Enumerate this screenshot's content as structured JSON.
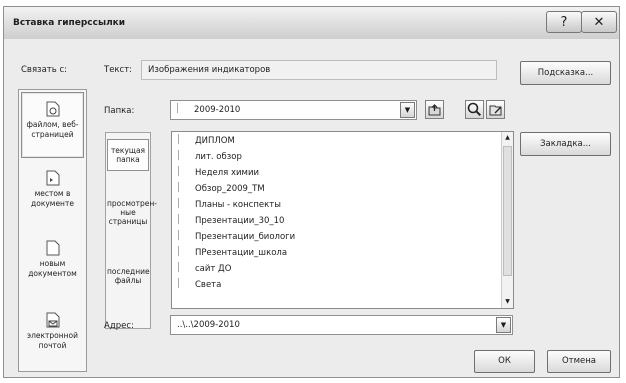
{
  "window": {
    "title": "Вставка гиперссылки",
    "help_glyph": "?",
    "close_glyph": "✕"
  },
  "link_to_label": "Связать с:",
  "link_options": [
    {
      "line1": "файлом, веб-",
      "line2": "страницей",
      "icon": "file-web-icon"
    },
    {
      "line1": "местом в",
      "line2": "документе",
      "icon": "document-place-icon"
    },
    {
      "line1": "новым",
      "line2": "документом",
      "icon": "new-document-icon"
    },
    {
      "line1": "электронной",
      "line2": "почтой",
      "icon": "email-icon"
    }
  ],
  "text": {
    "label": "Текст:",
    "value": "Изображения индикаторов"
  },
  "hint_button": "Подсказка...",
  "folder": {
    "label": "Папка:",
    "value": "2009-2010"
  },
  "bookmark_button": "Закладка...",
  "look_in": [
    {
      "line1": "текущая",
      "line2": "папка",
      "line3": ""
    },
    {
      "line1": "просмотрен-",
      "line2": "ные",
      "line3": "страницы"
    },
    {
      "line1": "последние",
      "line2": "файлы",
      "line3": ""
    }
  ],
  "files": [
    "ДИПЛОМ",
    "лит. обзор",
    "Неделя химии",
    "Обзор_2009_ТМ",
    "Планы - конспекты",
    "Презентации_30_10",
    "Презентации_биологи",
    "ПРезентации_школа",
    "сайт ДО",
    "Света"
  ],
  "address": {
    "label": "Адрес:",
    "value": "..\\..\\2009-2010"
  },
  "ok_button": "ОК",
  "cancel_button": "Отмена",
  "colors": {
    "dialog_bg": "#ececec",
    "border": "#8f8f8f"
  }
}
